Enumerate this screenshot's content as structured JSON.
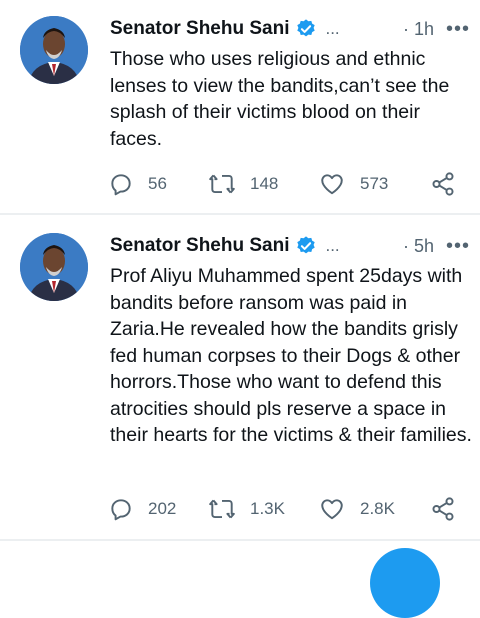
{
  "tweets": [
    {
      "author": "Senator Shehu Sani",
      "handle_truncated": "...",
      "time": "· 1h",
      "more": "•••",
      "text": "Those who uses religious and ethnic lenses to view the bandits,can’t see the splash of their victims blood on their faces.",
      "replies": "56",
      "retweets": "148",
      "likes": "573"
    },
    {
      "author": "Senator Shehu Sani",
      "handle_truncated": "...",
      "time": "· 5h",
      "more": "•••",
      "text": "Prof Aliyu Muhammed spent 25days with bandits before ransom was paid in Zaria.He revealed how the bandits grisly fed human corpses to their Dogs & other horrors.Those who want to defend this atrocities should pls reserve a space in their hearts for the victims & their families.",
      "replies": "202",
      "retweets": "1.3K",
      "likes": "2.8K"
    }
  ],
  "colors": {
    "text": "#0f1419",
    "secondary": "#536471",
    "verified": "#1d9bf0",
    "fab": "#1d9bf0"
  },
  "icons": [
    "verified-badge-icon",
    "reply-icon",
    "retweet-icon",
    "like-icon",
    "share-icon"
  ]
}
